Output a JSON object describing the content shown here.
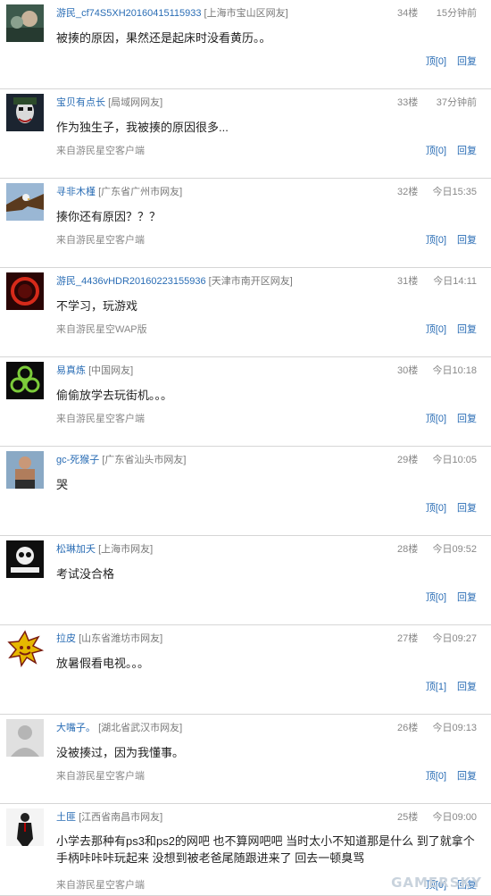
{
  "comments": [
    {
      "user": "游民_cf74S5XH20160415115933",
      "location": "[上海市宝山区网友]",
      "floor": "34楼",
      "time": "15分钟前",
      "content": "被揍的原因，果然还是起床时没看黄历。。",
      "source": "",
      "likes": "顶[0]",
      "reply": "回复",
      "avatar": "avatar-photo-icon"
    },
    {
      "user": "宝贝有点长",
      "location": "[局域网网友]",
      "floor": "33楼",
      "time": "37分钟前",
      "content": "作为独生子，我被揍的原因很多...",
      "source": "来自游民星空客户端",
      "likes": "顶[0]",
      "reply": "回复",
      "avatar": "joker-avatar-icon"
    },
    {
      "user": "寻非木槿",
      "location": "[广东省广州市网友]",
      "floor": "32楼",
      "time": "今日15:35",
      "content": "揍你还有原因？？？",
      "source": "来自游民星空客户端",
      "likes": "顶[0]",
      "reply": "回复",
      "avatar": "eagle-avatar-icon"
    },
    {
      "user": "游民_4436vHDR20160223155936",
      "location": "[天津市南开区网友]",
      "floor": "31楼",
      "time": "今日14:11",
      "content": "不学习，玩游戏",
      "source": "来自游民星空WAP版",
      "likes": "顶[0]",
      "reply": "回复",
      "avatar": "red-ring-avatar-icon"
    },
    {
      "user": "易真炼",
      "location": "[中国网友]",
      "floor": "30楼",
      "time": "今日10:18",
      "content": "偷偷放学去玩街机。。。",
      "source": "来自游民星空客户端",
      "likes": "顶[0]",
      "reply": "回复",
      "avatar": "biohazard-avatar-icon"
    },
    {
      "user": "gc-死猴子",
      "location": "[广东省汕头市网友]",
      "floor": "29楼",
      "time": "今日10:05",
      "content": "哭",
      "source": "",
      "likes": "顶[0]",
      "reply": "回复",
      "avatar": "person-avatar-icon"
    },
    {
      "user": "松琳加夭",
      "location": "[上海市网友]",
      "floor": "28楼",
      "time": "今日09:52",
      "content": "考试没合格",
      "source": "",
      "likes": "顶[0]",
      "reply": "回复",
      "avatar": "skull-logo-avatar-icon"
    },
    {
      "user": "拉皮",
      "location": "[山东省潍坊市网友]",
      "floor": "27楼",
      "time": "今日09:27",
      "content": "放暑假看电视。。。",
      "source": "",
      "likes": "顶[1]",
      "reply": "回复",
      "avatar": "sun-face-avatar-icon"
    },
    {
      "user": "大嘴子。",
      "location": "[湖北省武汉市网友]",
      "floor": "26楼",
      "time": "今日09:13",
      "content": "没被揍过，因为我懂事。",
      "source": "来自游民星空客户端",
      "likes": "顶[0]",
      "reply": "回复",
      "avatar": "default-avatar-icon"
    },
    {
      "user": "土匪",
      "location": "[江西省南昌市网友]",
      "floor": "25楼",
      "time": "今日09:00",
      "content": "小学去那种有ps3和ps2的网吧 也不算网吧吧 当时太小不知道那是什么 到了就拿个手柄咔咔咔玩起来 没想到被老爸尾随跟进来了 回去一顿臭骂",
      "source": "来自游民星空客户端",
      "likes": "顶[0]",
      "reply": "回复",
      "avatar": "hitman-avatar-icon"
    }
  ],
  "watermark": "GAMERSKY"
}
